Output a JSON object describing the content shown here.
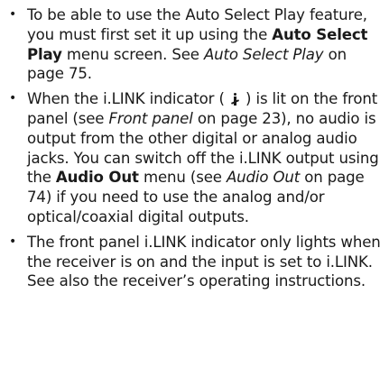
{
  "bullet_glyph": "•",
  "notes": [
    {
      "t1": "To be able to use the Auto Select Play feature, you must first set it up using the ",
      "b1": "Auto Select Play",
      "t2": " menu screen. See ",
      "i1": "Auto Select Play",
      "t3": " on page 75."
    },
    {
      "t1": "When the i.LINK indicator ( ",
      "icon": "ilink-icon",
      "t2": " ) is lit on the front panel (see ",
      "i1": "Front panel",
      "t3": " on page 23), no audio is output from the other digital or analog audio jacks. You can switch off the i.LINK output using the ",
      "b1": "Audio Out",
      "t4": " menu (see ",
      "i2": "Audio Out",
      "t5": " on page 74) if you need to use the analog and/or optical/coaxial digital outputs."
    },
    {
      "t1": "The front panel i.LINK indicator only lights when the receiver is on and the input is set to i.LINK. See also the receiver’s operating instructions."
    }
  ]
}
